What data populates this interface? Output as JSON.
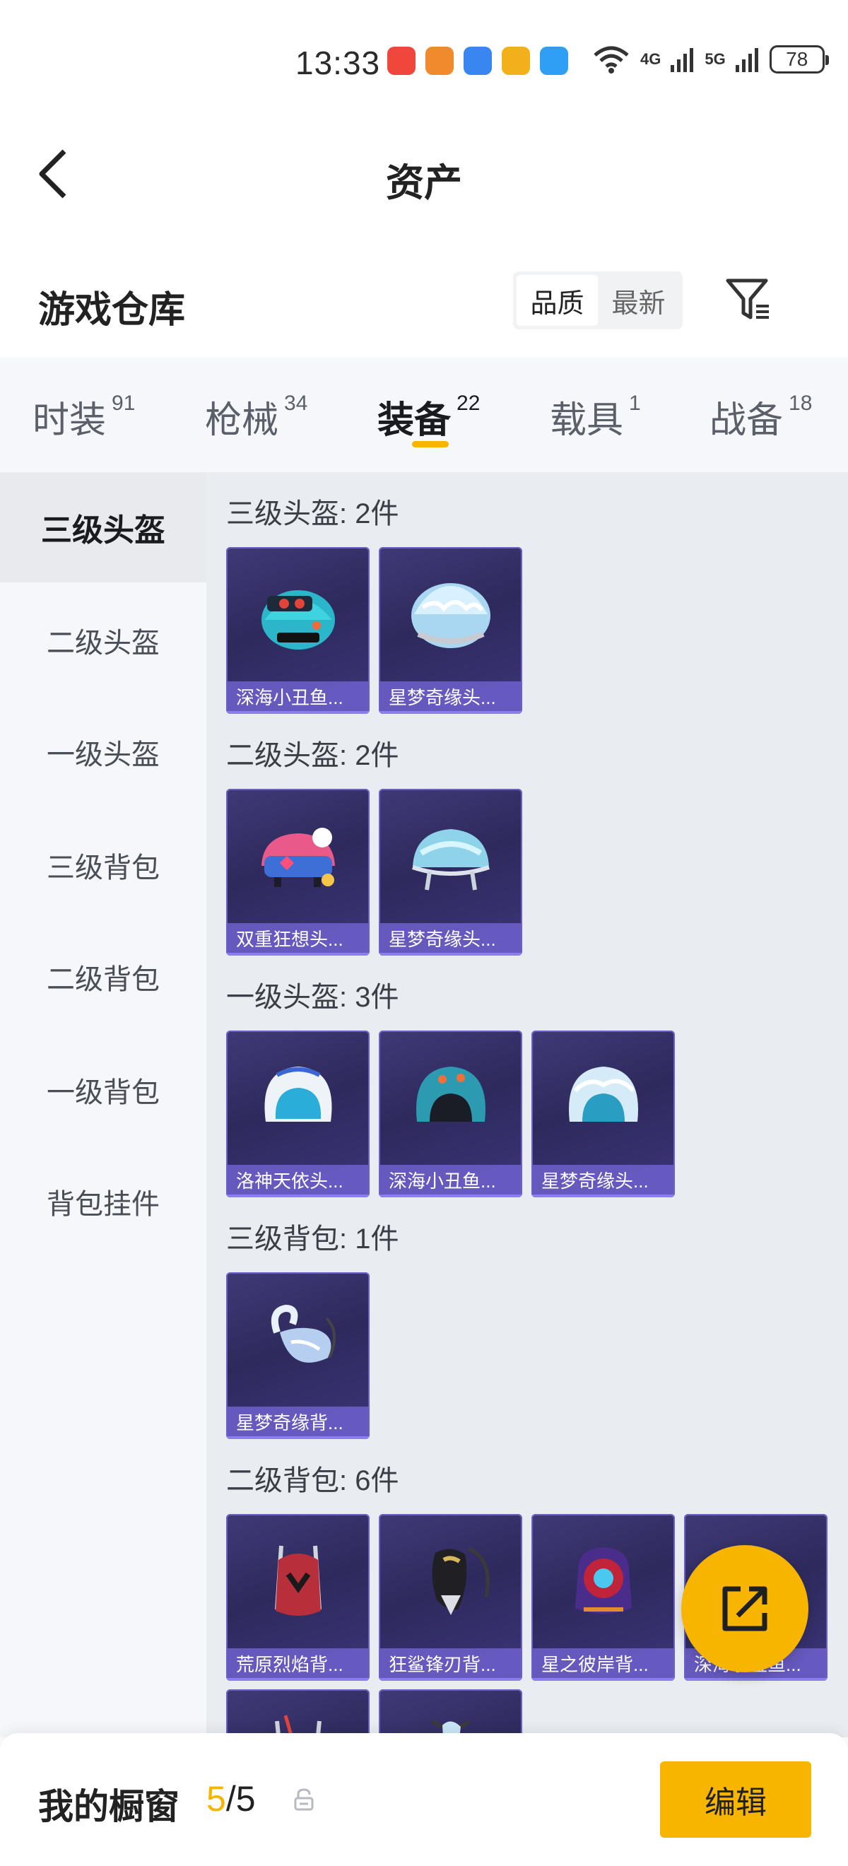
{
  "status_bar": {
    "time": "13:33",
    "net1": "4G",
    "net2": "5G",
    "battery": "78"
  },
  "header": {
    "title": "资产"
  },
  "section": {
    "title": "游戏仓库",
    "sort": [
      "品质",
      "最新"
    ]
  },
  "tabs": [
    {
      "label": "时装",
      "count": "91"
    },
    {
      "label": "枪械",
      "count": "34"
    },
    {
      "label": "装备",
      "count": "22"
    },
    {
      "label": "载具",
      "count": "1"
    },
    {
      "label": "战备",
      "count": "18"
    }
  ],
  "sidebar": [
    "三级头盔",
    "二级头盔",
    "一级头盔",
    "三级背包",
    "二级背包",
    "一级背包",
    "背包挂件"
  ],
  "groups": [
    {
      "title": "三级头盔: 2件",
      "items": [
        "深海小丑鱼...",
        "星梦奇缘头..."
      ]
    },
    {
      "title": "二级头盔: 2件",
      "items": [
        "双重狂想头...",
        "星梦奇缘头..."
      ]
    },
    {
      "title": "一级头盔: 3件",
      "items": [
        "洛神天依头...",
        "深海小丑鱼...",
        "星梦奇缘头..."
      ]
    },
    {
      "title": "三级背包: 1件",
      "items": [
        "星梦奇缘背..."
      ]
    },
    {
      "title": "二级背包: 6件",
      "items": [
        "荒原烈焰背...",
        "狂鲨锋刃背...",
        "星之彼岸背...",
        "深海小丑鱼..."
      ]
    }
  ],
  "bottom_bar": {
    "title": "我的橱窗",
    "current": "5",
    "total": "/5",
    "edit": "编辑"
  }
}
